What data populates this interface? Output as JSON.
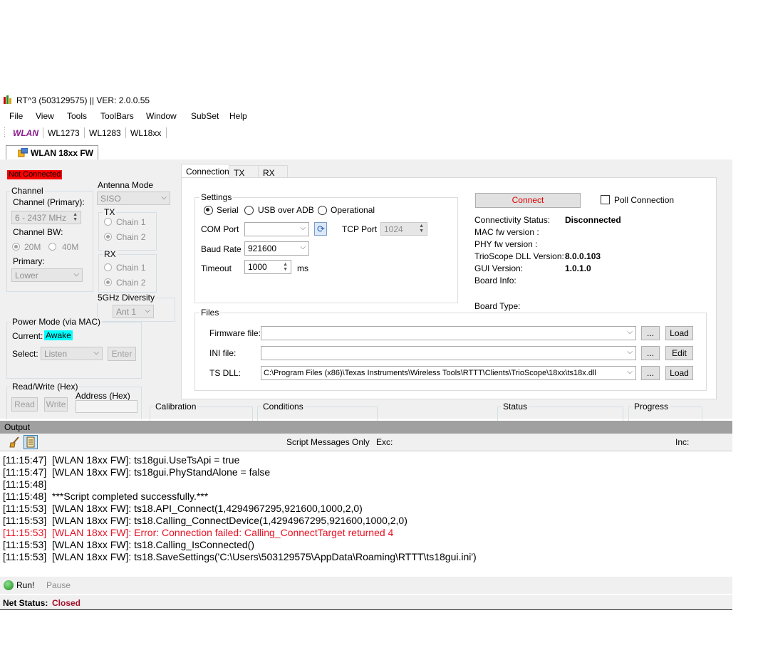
{
  "window": {
    "title": "RT^3 (503129575) || VER: 2.0.0.55"
  },
  "menu": [
    "File",
    "View",
    "Tools",
    "ToolBars",
    "Window",
    "SubSet",
    "Help"
  ],
  "toolbar": {
    "wlan": "WLAN",
    "items": [
      "WL1273",
      "WL1283",
      "WL18xx"
    ]
  },
  "doc_tab": "WLAN 18xx FW",
  "left": {
    "conn_status": "Not Connected",
    "channel": {
      "group": "Channel",
      "primary_label": "Channel (Primary):",
      "primary_value": "6  - 2437 MHz",
      "bw_label": "Channel BW:",
      "bw_20": "20M",
      "bw_40": "40M",
      "primary2_label": "Primary:",
      "primary2_value": "Lower"
    },
    "antenna": {
      "label": "Antenna Mode",
      "mode": "SISO",
      "tx": "TX",
      "tx_chain1": "Chain 1",
      "tx_chain2": "Chain 2",
      "rx": "RX",
      "rx_chain1": "Chain 1",
      "rx_chain2": "Chain 2",
      "diversity_label": "5GHz Diversity",
      "diversity_value": "Ant 1"
    },
    "power": {
      "group": "Power Mode (via MAC)",
      "current_label": "Current:",
      "current_value": "Awake",
      "select_label": "Select:",
      "select_value": "Listen",
      "enter": "Enter"
    },
    "rw": {
      "group": "Read/Write (Hex)",
      "read": "Read",
      "write": "Write",
      "address_label": "Address (Hex)"
    }
  },
  "tabs": [
    "Connection",
    "TX",
    "RX"
  ],
  "settings": {
    "group": "Settings",
    "serial": "Serial",
    "usb": "USB over ADB",
    "operational": "Operational",
    "com_label": "COM Port",
    "tcp_label": "TCP Port",
    "tcp_value": "1024",
    "baud_label": "Baud Rate",
    "baud_value": "921600",
    "timeout_label": "Timeout",
    "timeout_value": "1000",
    "timeout_unit": "ms"
  },
  "connect": {
    "button": "Connect",
    "poll": "Poll Connection",
    "status_label": "Connectivity Status:",
    "status_value": "Disconnected",
    "mac_label": "MAC fw version :",
    "phy_label": "PHY fw version :",
    "dll_label": "TrioScope DLL Version:",
    "dll_value": "8.0.0.103",
    "gui_label": "GUI Version:",
    "gui_value": "1.0.1.0",
    "board_info": "Board Info:",
    "board_type": "Board Type:"
  },
  "files": {
    "group": "Files",
    "firmware_label": "Firmware file:",
    "ini_label": "INI file:",
    "tsdll_label": "TS DLL:",
    "tsdll_value": "C:\\Program Files (x86)\\Texas Instruments\\Wireless Tools\\RTTT\\Clients\\TrioScope\\18xx\\ts18x.dll",
    "browse": "...",
    "load": "Load",
    "edit": "Edit"
  },
  "bottom_groups": {
    "calibration": "Calibration",
    "conditions": "Conditions",
    "status": "Status",
    "progress": "Progress"
  },
  "output": {
    "title": "Output",
    "script_only": "Script Messages Only",
    "exc": "Exc:",
    "inc": "Inc:",
    "lines": [
      {
        "text": "[11:15:47]  [WLAN 18xx FW]: ts18gui.UseTsApi = true",
        "error": false
      },
      {
        "text": "[11:15:47]  [WLAN 18xx FW]: ts18gui.PhyStandAlone = false",
        "error": false
      },
      {
        "text": "[11:15:48]",
        "error": false
      },
      {
        "text": "[11:15:48]  ***Script completed successfully.***",
        "error": false
      },
      {
        "text": "[11:15:53]  [WLAN 18xx FW]: ts18.API_Connect(1,4294967295,921600,1000,2,0)",
        "error": false
      },
      {
        "text": "[11:15:53]  [WLAN 18xx FW]: ts18.Calling_ConnectDevice(1,4294967295,921600,1000,2,0)",
        "error": false
      },
      {
        "text": "[11:15:53]  [WLAN 18xx FW]: Error: Connection failed: Calling_ConnectTarget returned 4",
        "error": true
      },
      {
        "text": "[11:15:53]  [WLAN 18xx FW]: ts18.Calling_IsConnected()",
        "error": false
      },
      {
        "text": "[11:15:53]  [WLAN 18xx FW]: ts18.SaveSettings('C:\\Users\\503129575\\AppData\\Roaming\\RTTT\\ts18gui.ini')",
        "error": false
      }
    ]
  },
  "run": {
    "run": "Run!",
    "pause": "Pause"
  },
  "net": {
    "label": "Net Status:",
    "value": "Closed"
  },
  "colors": {
    "error_red": "#e81123",
    "not_connected_bg": "#ff0000",
    "awake_bg": "#00ffff",
    "wlan_purple": "#8b1a8b",
    "closed": "#a0102a"
  }
}
